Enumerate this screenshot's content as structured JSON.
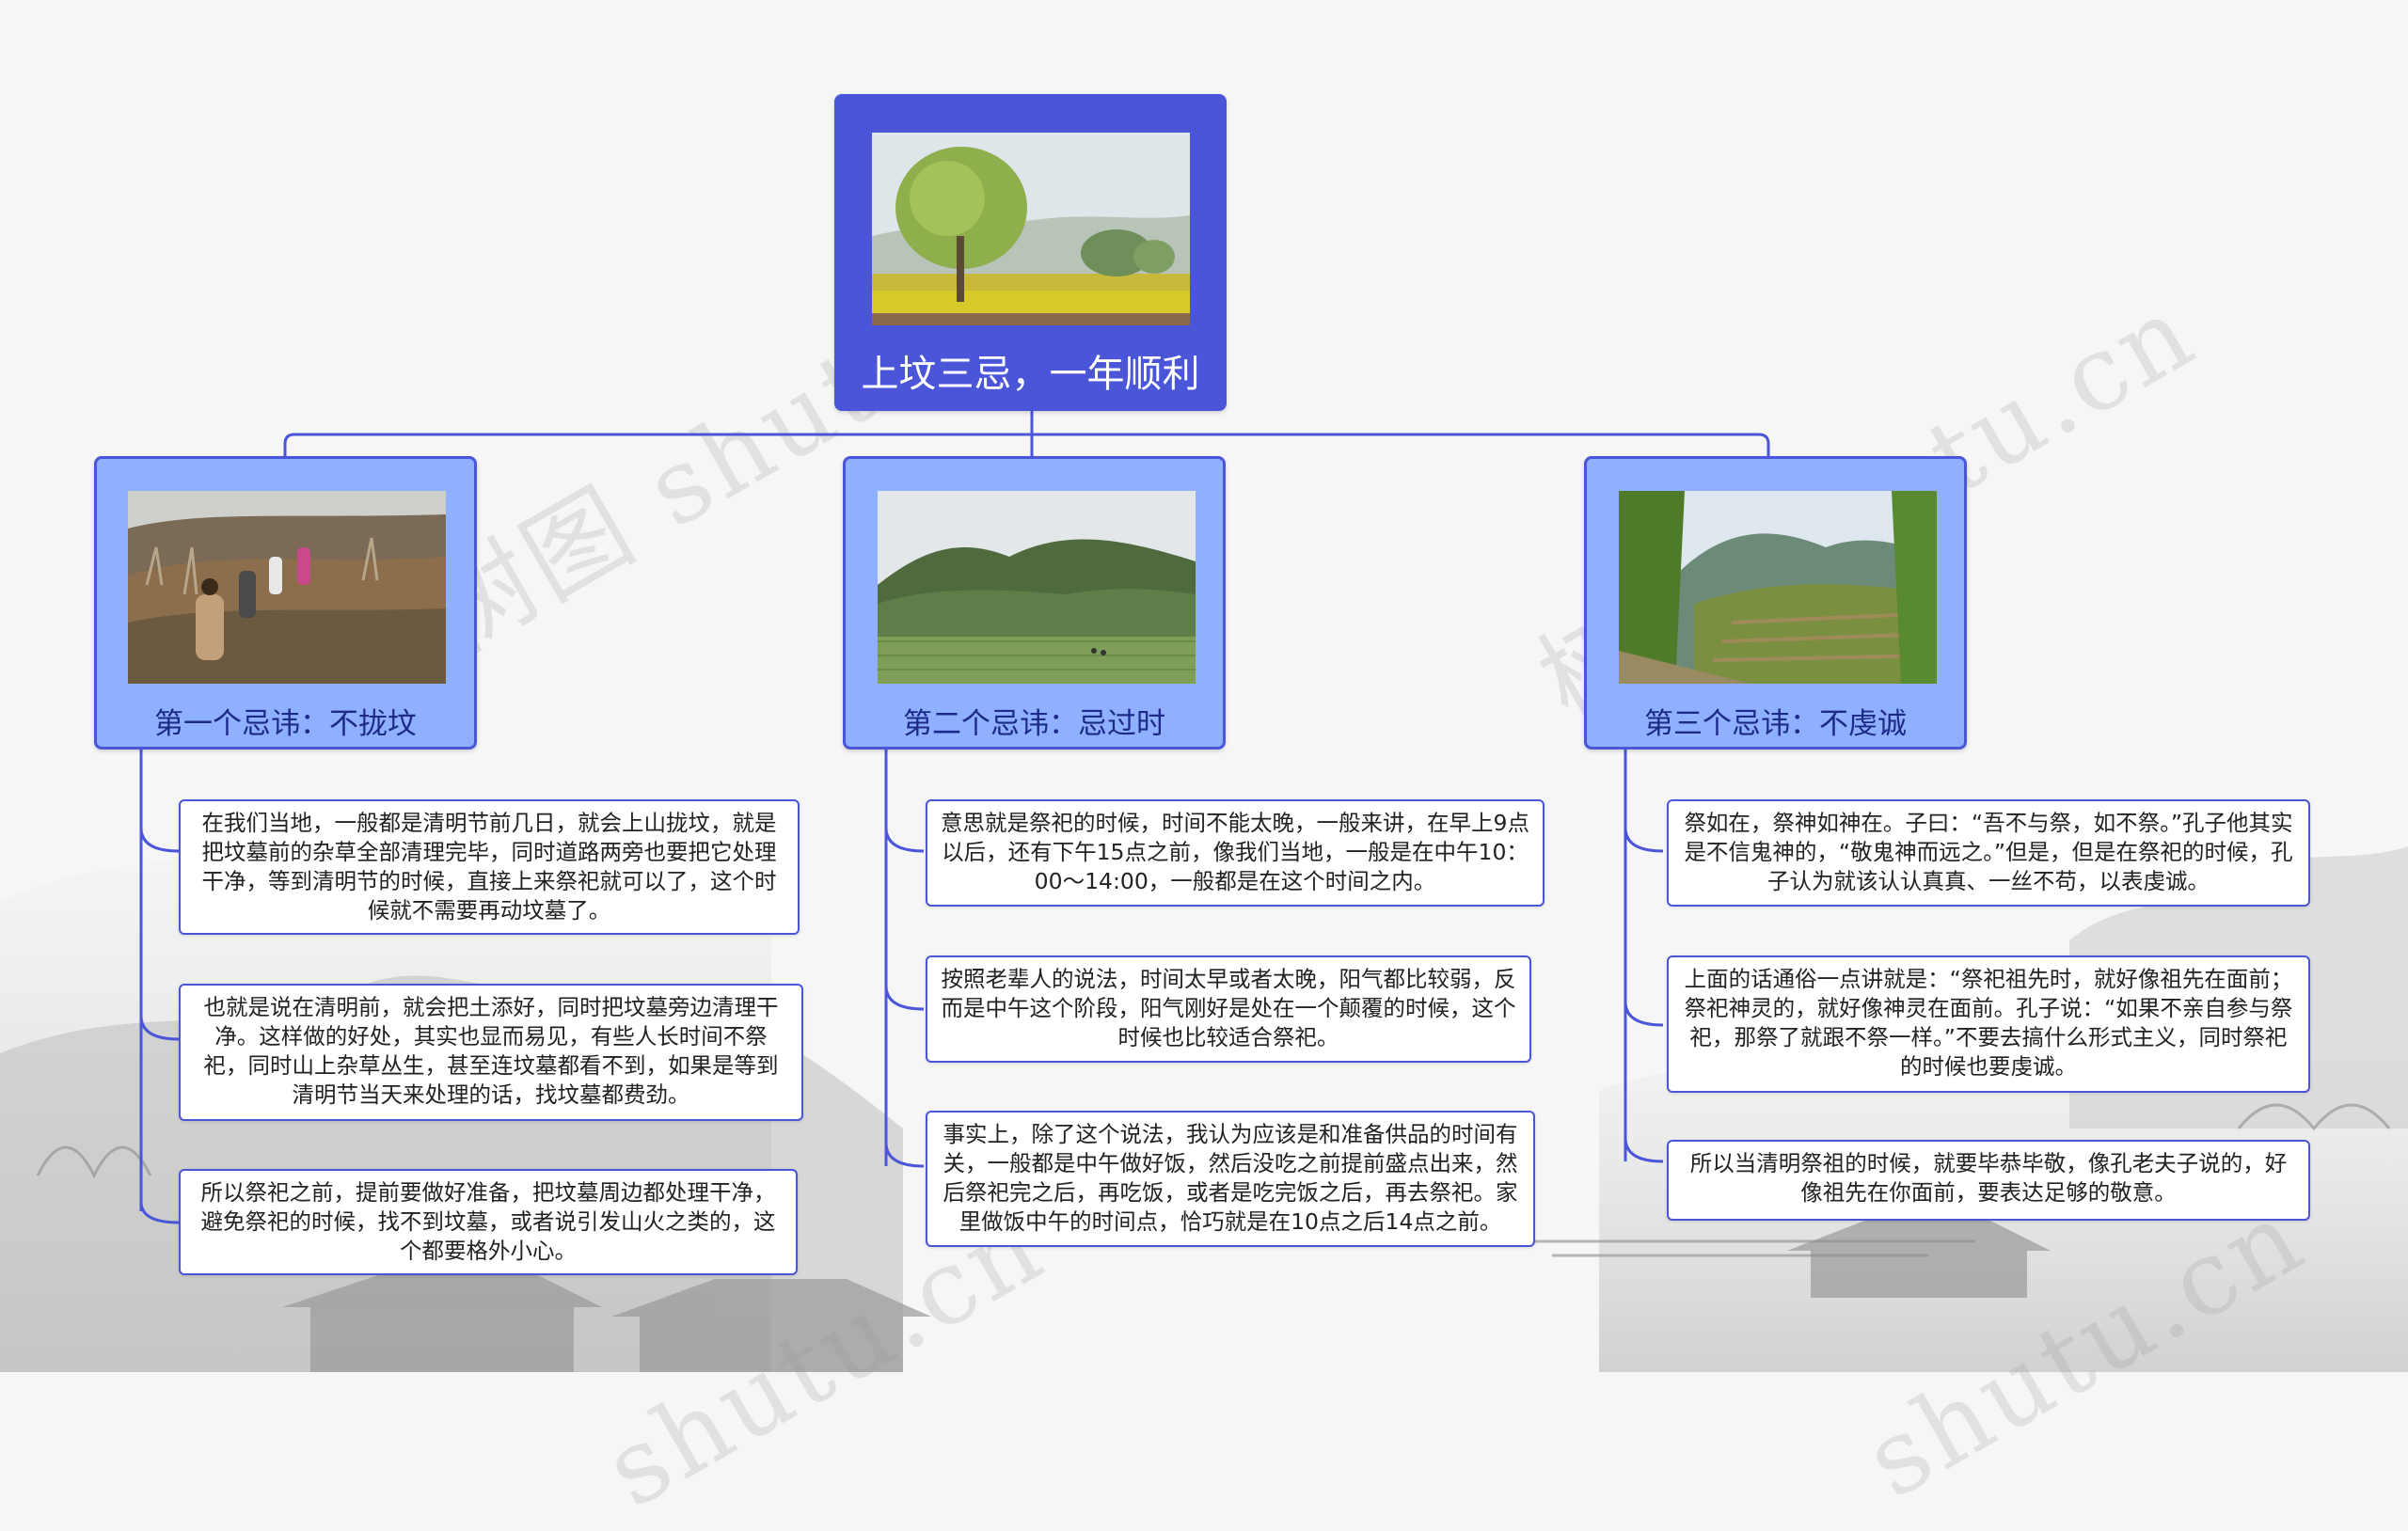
{
  "root": {
    "title": "上坟三忌，一年顺利"
  },
  "branches": [
    {
      "title": "第一个忌讳：不拢坟",
      "items": [
        "在我们当地，一般都是清明节前几日，就会上山拢坟，就是把坟墓前的杂草全部清理完毕，同时道路两旁也要把它处理干净，等到清明节的时候，直接上来祭祀就可以了，这个时候就不需要再动坟墓了。",
        "也就是说在清明前，就会把土添好，同时把坟墓旁边清理干净。这样做的好处，其实也显而易见，有些人长时间不祭祀，同时山上杂草丛生，甚至连坟墓都看不到，如果是等到清明节当天来处理的话，找坟墓都费劲。",
        "所以祭祀之前，提前要做好准备，把坟墓周边都处理干净，避免祭祀的时候，找不到坟墓，或者说引发山火之类的，这个都要格外小心。"
      ]
    },
    {
      "title": "第二个忌讳：忌过时",
      "items": [
        "意思就是祭祀的时候，时间不能太晚，一般来讲，在早上9点以后，还有下午15点之前，像我们当地，一般是在中午10：00～14:00，一般都是在这个时间之内。",
        "按照老辈人的说法，时间太早或者太晚，阳气都比较弱，反而是中午这个阶段，阳气刚好是处在一个颠覆的时候，这个时候也比较适合祭祀。",
        "事实上，除了这个说法，我认为应该是和准备供品的时间有关，一般都是中午做好饭，然后没吃之前提前盛点出来，然后祭祀完之后，再吃饭，或者是吃完饭之后，再去祭祀。家里做饭中午的时间点，恰巧就是在10点之后14点之前。"
      ]
    },
    {
      "title": "第三个忌讳：不虔诚",
      "items": [
        "祭如在，祭神如神在。子曰：“吾不与祭，如不祭。”孔子他其实是不信鬼神的，“敬鬼神而远之。”但是，但是在祭祀的时候，孔子认为就该认认真真、一丝不苟，以表虔诚。",
        "上面的话通俗一点讲就是：“祭祀祖先时，就好像祖先在面前；祭祀神灵的，就好像神灵在面前。孔子说：“如果不亲自参与祭祀，那祭了就跟不祭一样。”不要去搞什么形式主义，同时祭祀的时候也要虔诚。",
        "所以当清明祭祖的时候，就要毕恭毕敬，像孔老夫子说的，好像祖先在你面前，要表达足够的敬意。"
      ]
    }
  ],
  "watermarks": [
    "树图 shutu.cn",
    "树图 shutu.cn",
    "shutu.cn",
    "shutu.cn"
  ],
  "colors": {
    "node_fill": "#8fb0ff",
    "node_border": "#4a55d8",
    "root_fill": "#4a55d8",
    "connector": "#4a55d8"
  },
  "icons": [
    "tree-field-photo",
    "hill-walkers-photo",
    "green-valley-photo",
    "mountain-terrace-photo"
  ]
}
